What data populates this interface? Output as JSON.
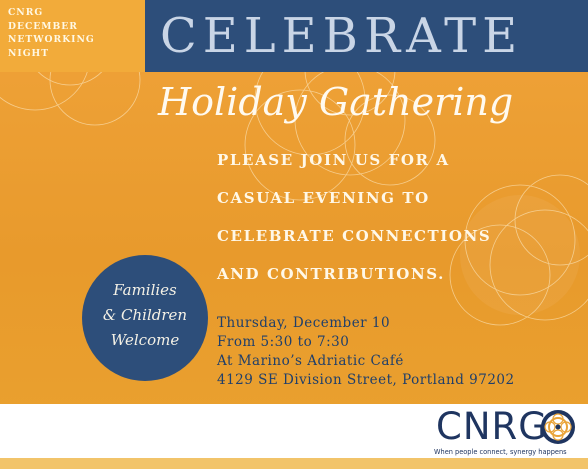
{
  "header": {
    "eyebrow_lines": [
      "CNRG",
      "DECEMBER",
      "NETWORKING",
      "NIGHT"
    ],
    "title": "CELEBRATE"
  },
  "subtitle": "Holiday Gathering",
  "invitation_lines": [
    "PLEASE JOIN US FOR A",
    "CASUAL EVENING TO",
    "CELEBRATE CONNECTIONS",
    "AND CONTRIBUTIONS."
  ],
  "badge_lines": [
    "Families",
    "& Children",
    "Welcome"
  ],
  "event_details": [
    "Thursday, December 10",
    "From 5:30 to 7:30",
    "At Marino’s Adriatic Café",
    "4129 SE Division Street, Portland 97202"
  ],
  "logo": {
    "wordmark": "CNRG",
    "tagline": "When people connect, synergy happens"
  },
  "colors": {
    "background_orange": "#eba031",
    "banner_navy": "#2d4e7a",
    "title_light_blue": "#c9d5e6",
    "details_navy": "#1f3f6b"
  }
}
